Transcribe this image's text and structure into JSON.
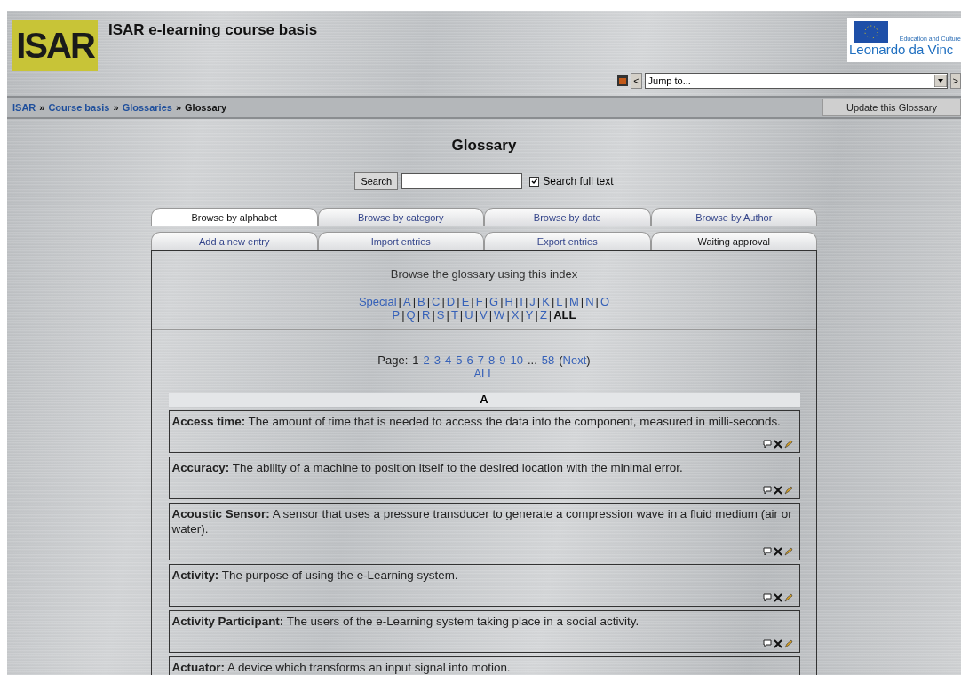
{
  "header": {
    "logo_text": "ISAR",
    "title": "ISAR e-learning course basis",
    "partner_logo": {
      "caption": "Education and Culture",
      "name": "Leonardo da Vinc"
    }
  },
  "jump": {
    "prev": "<",
    "placeholder": "Jump to...",
    "next": ">"
  },
  "breadcrumb": [
    {
      "label": "ISAR",
      "link": true
    },
    {
      "label": "Course basis",
      "link": true
    },
    {
      "label": "Glossaries",
      "link": true
    },
    {
      "label": "Glossary",
      "link": false
    }
  ],
  "breadcrumb_separator": "»",
  "update_button": "Update this Glossary",
  "page_title": "Glossary",
  "search": {
    "button": "Search",
    "full_text_label": "Search full text",
    "full_text_checked": true
  },
  "tab_rows": [
    [
      {
        "label": "Browse by alphabet",
        "selected": true,
        "link": true
      },
      {
        "label": "Browse by category",
        "selected": false,
        "link": true
      },
      {
        "label": "Browse by date",
        "selected": false,
        "link": true
      },
      {
        "label": "Browse by Author",
        "selected": false,
        "link": true
      }
    ],
    [
      {
        "label": "Add a new entry",
        "selected": false,
        "link": true
      },
      {
        "label": "Import entries",
        "selected": false,
        "link": true
      },
      {
        "label": "Export entries",
        "selected": false,
        "link": true
      },
      {
        "label": "Waiting approval",
        "selected": false,
        "link": false
      }
    ]
  ],
  "index_caption": "Browse the glossary using this index",
  "letter_rows": [
    [
      {
        "label": "Special",
        "selected": false
      },
      {
        "label": "A",
        "selected": false
      },
      {
        "label": "B",
        "selected": false
      },
      {
        "label": "C",
        "selected": false
      },
      {
        "label": "D",
        "selected": false
      },
      {
        "label": "E",
        "selected": false
      },
      {
        "label": "F",
        "selected": false
      },
      {
        "label": "G",
        "selected": false
      },
      {
        "label": "H",
        "selected": false
      },
      {
        "label": "I",
        "selected": false
      },
      {
        "label": "J",
        "selected": false
      },
      {
        "label": "K",
        "selected": false
      },
      {
        "label": "L",
        "selected": false
      },
      {
        "label": "M",
        "selected": false
      },
      {
        "label": "N",
        "selected": false
      },
      {
        "label": "O",
        "selected": false
      }
    ],
    [
      {
        "label": "P",
        "selected": false
      },
      {
        "label": "Q",
        "selected": false
      },
      {
        "label": "R",
        "selected": false
      },
      {
        "label": "S",
        "selected": false
      },
      {
        "label": "T",
        "selected": false
      },
      {
        "label": "U",
        "selected": false
      },
      {
        "label": "V",
        "selected": false
      },
      {
        "label": "W",
        "selected": false
      },
      {
        "label": "X",
        "selected": false
      },
      {
        "label": "Y",
        "selected": false
      },
      {
        "label": "Z",
        "selected": false
      },
      {
        "label": "ALL",
        "selected": true
      }
    ]
  ],
  "letter_separator": "|",
  "paging": {
    "label": "Page:",
    "pages": [
      {
        "label": "1",
        "selected": true
      },
      {
        "label": "2",
        "selected": false
      },
      {
        "label": "3",
        "selected": false
      },
      {
        "label": "4",
        "selected": false
      },
      {
        "label": "5",
        "selected": false
      },
      {
        "label": "6",
        "selected": false
      },
      {
        "label": "7",
        "selected": false
      },
      {
        "label": "8",
        "selected": false
      },
      {
        "label": "9",
        "selected": false
      },
      {
        "label": "10",
        "selected": false
      },
      {
        "label": "...",
        "kind": "gap"
      },
      {
        "label": "58",
        "selected": false
      }
    ],
    "next_open": "(",
    "next": "Next",
    "next_close": ")",
    "all": "ALL"
  },
  "section_letter": "A",
  "entries": [
    {
      "term": "Access time:",
      "definition": "The amount of time that is needed to access the data into the component, measured in milli-seconds."
    },
    {
      "term": "Accuracy:",
      "definition": "The ability of a machine to position itself to the desired location with the minimal error."
    },
    {
      "term": "Acoustic Sensor:",
      "definition": "A sensor that uses a pressure transducer to generate a compression wave in a fluid medium (air or water)."
    },
    {
      "term": "Activity:",
      "definition": "The purpose of using the e-Learning system."
    },
    {
      "term": "Activity Participant:",
      "definition": "The users of the e-Learning system taking place in a social activity."
    },
    {
      "term": "Actuator:",
      "definition": "A device which transforms an input signal into motion.",
      "actions_visible": false
    }
  ]
}
